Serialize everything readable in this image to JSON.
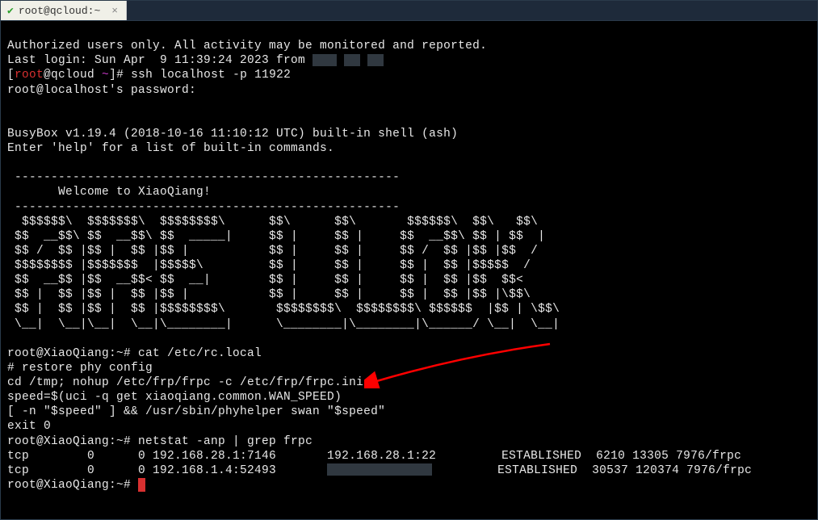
{
  "tab": {
    "title": "root@qcloud:~",
    "close": "×"
  },
  "term": {
    "line_auth": "Authorized users only. All activity may be monitored and reported.",
    "line_lastlogin": "Last login: Sun Apr  9 11:39:24 2023 from ",
    "prompt1_br_l": "[",
    "prompt1_user": "root",
    "prompt1_at": "@qcloud ",
    "prompt1_tilde": "~",
    "prompt1_br_r": "]# ",
    "cmd_ssh": "ssh localhost -p 11922",
    "line_pwd": "root@localhost's password:",
    "line_busybox": "BusyBox v1.19.4 (2018-10-16 11:10:12 UTC) built-in shell (ash)",
    "line_help": "Enter 'help' for a list of built-in commands.",
    "banner1": " -----------------------------------------------------",
    "banner2": "       Welcome to XiaoQiang!",
    "banner3": " -----------------------------------------------------",
    "art1": "  $$$$$$\\  $$$$$$$\\  $$$$$$$$\\      $$\\      $$\\       $$$$$$\\  $$\\   $$\\",
    "art2": " $$  __$$\\ $$  __$$\\ $$  _____|     $$ |     $$ |     $$  __$$\\ $$ | $$  |",
    "art3": " $$ /  $$ |$$ |  $$ |$$ |           $$ |     $$ |     $$ /  $$ |$$ |$$  /",
    "art4": " $$$$$$$$ |$$$$$$$  |$$$$$\\         $$ |     $$ |     $$ |  $$ |$$$$$  /",
    "art5": " $$  __$$ |$$  __$$< $$  __|        $$ |     $$ |     $$ |  $$ |$$  $$<",
    "art6": " $$ |  $$ |$$ |  $$ |$$ |           $$ |     $$ |     $$ |  $$ |$$ |\\$$\\ ",
    "art7": " $$ |  $$ |$$ |  $$ |$$$$$$$$\\       $$$$$$$$\\  $$$$$$$$\\ $$$$$$  |$$ | \\$$\\ ",
    "art8": " \\__|  \\__|\\__|  \\__|\\________|      \\________|\\________|\\______/ \\__|  \\__|",
    "prompt2": "root@XiaoQiang:~# ",
    "cmd_cat": "cat /etc/rc.local",
    "rc1": "# restore phy config",
    "rc2": "cd /tmp; nohup /etc/frp/frpc -c /etc/frp/frpc.ini &",
    "rc3": "speed=$(uci -q get xiaoqiang.common.WAN_SPEED)",
    "rc4": "[ -n \"$speed\" ] && /usr/sbin/phyhelper swan \"$speed\"",
    "rc5": "exit 0",
    "cmd_netstat": "netstat -anp | grep frpc",
    "ns1_a": "tcp        0      0 192.168.28.1:7146       192.168.28.1:22         ESTABLISHED  6210 13305 7976/frpc",
    "ns2_a": "tcp        0      0 192.168.1.4:52493       ",
    "ns2_b": "         ESTABLISHED  30537 120374 7976/frpc"
  }
}
